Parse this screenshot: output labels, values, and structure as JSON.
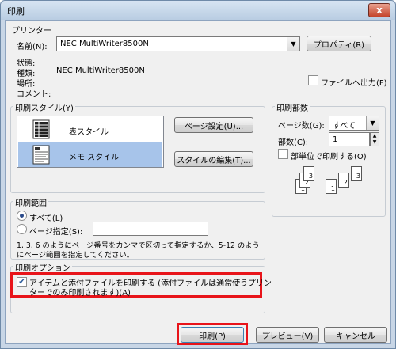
{
  "window": {
    "title": "印刷",
    "close_glyph": "x"
  },
  "printer": {
    "group_label": "プリンター",
    "name_label": "名前(N):",
    "name_value": "NEC MultiWriter8500N",
    "properties_button": "プロパティ(R)",
    "status_label": "状態:",
    "type_label": "種類:",
    "type_value": "NEC MultiWriter8500N",
    "location_label": "場所:",
    "comment_label": "コメント:",
    "print_to_file_label": "ファイルへ出力(F)"
  },
  "print_style": {
    "group_label": "印刷スタイル(Y)",
    "items": [
      {
        "label": "表スタイル"
      },
      {
        "label": "メモ スタイル"
      }
    ],
    "selected_index": 1,
    "page_setup_button": "ページ設定(U)...",
    "edit_style_button": "スタイルの編集(T)..."
  },
  "copies": {
    "group_label": "印刷部数",
    "pages_label": "ページ数(G):",
    "pages_value": "すべて",
    "copies_label": "部数(C):",
    "copies_value": "1",
    "collate_label": "部単位で印刷する(O)",
    "collate_pages": [
      "1",
      "2",
      "3",
      "1",
      "2",
      "3"
    ]
  },
  "range": {
    "group_label": "印刷範囲",
    "all_label": "すべて(L)",
    "pages_label": "ページ指定(S):",
    "pages_value": "",
    "hint_line1": "1, 3, 6 のようにページ番号をカンマで区切って指定するか、5-12 のよう",
    "hint_line2": "にページ範囲を指定してください。"
  },
  "options": {
    "group_label": "印刷オプション",
    "attachments_line1": "アイテムと添付ファイルを印刷する (添付ファイルは通常使うプリン",
    "attachments_line2": "ターでのみ印刷されます)(A)"
  },
  "footer": {
    "print_button": "印刷(P)",
    "preview_button": "プレビュー(V)",
    "cancel_button": "キャンセル"
  },
  "colors": {
    "highlight": "#e8141a",
    "selection": "#a7c4ea"
  }
}
